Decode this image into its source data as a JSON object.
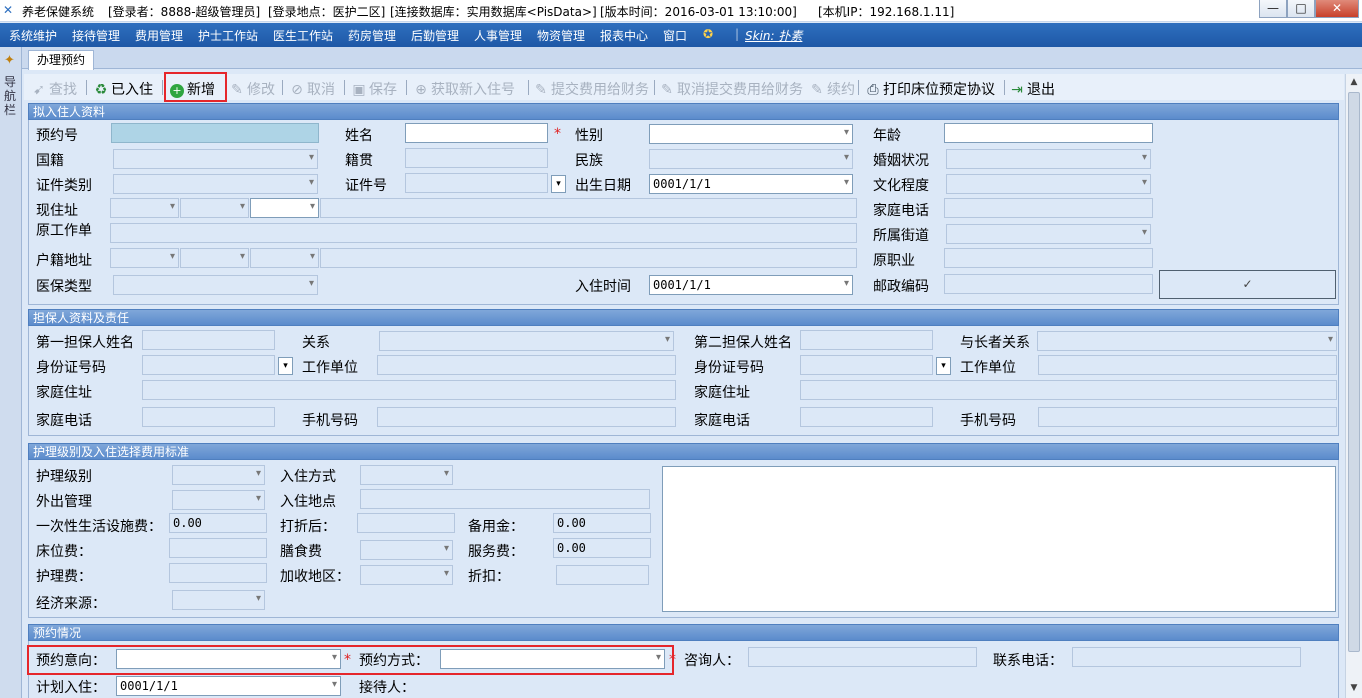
{
  "titlebar": {
    "app": "养老保健系统",
    "user": "[登录者：8888-超级管理员]",
    "location": "[登录地点：医护二区]",
    "db": "[连接数据库：实用数据库<PisData>]",
    "version": "[版本时间：2016-03-01 13:10:00]",
    "ip": "[本机IP：192.168.1.11]",
    "min": "—",
    "max": "□",
    "close": "✕"
  },
  "menu": [
    "系统维护",
    "接待管理",
    "费用管理",
    "护士工作站",
    "医生工作站",
    "药房管理",
    "后勤管理",
    "人事管理",
    "物资管理",
    "报表中心",
    "窗口"
  ],
  "skin_label": "Skin: 扑素",
  "left_strip_label": "导航栏",
  "tab_label": "办理预约",
  "toolbar": {
    "find": "查找",
    "checked_in": "已入住",
    "add": "新增",
    "edit": "修改",
    "cancel": "取消",
    "save": "保存",
    "get_new": "获取新入住号",
    "submit_fee": "提交费用给财务",
    "cancel_submit": "取消提交费用给财务",
    "renew": "续约",
    "print": "打印床位预定协议",
    "exit": "退出"
  },
  "sec1": {
    "title": "拟入住人资料",
    "reserve_no": "预约号",
    "name": "姓名",
    "gender": "性别",
    "age": "年龄",
    "nationality": "国籍",
    "native": "籍贯",
    "ethnic": "民族",
    "marital": "婚姻状况",
    "id_type": "证件类别",
    "id_no": "证件号",
    "birth": "出生日期",
    "birth_value": "0001/1/1",
    "education": "文化程度",
    "address": "现住址",
    "home_phone": "家庭电话",
    "former_work": "原工作单",
    "street": "所属街道",
    "hukou": "户籍地址",
    "former_job": "原职业",
    "insurance": "医保类型",
    "checkin_time": "入住时间",
    "checkin_value": "0001/1/1",
    "postcode": "邮政编码"
  },
  "sec2": {
    "title": "担保人资料及责任",
    "g1_name": "第一担保人姓名",
    "relation": "关系",
    "g2_name": "第二担保人姓名",
    "elder_relation": "与长者关系",
    "id_no": "身份证号码",
    "work_unit": "工作单位",
    "home_address": "家庭住址",
    "home_phone": "家庭电话",
    "mobile": "手机号码"
  },
  "sec3": {
    "title": "护理级别及入住选择费用标准",
    "care_level": "护理级别",
    "checkin_mode": "入住方式",
    "outing": "外出管理",
    "checkin_place": "入住地点",
    "facility_fee": "一次性生活设施费：",
    "facility_value": "0.00",
    "after_discount": "打折后：",
    "reserve_fund": "备用金：",
    "reserve_value": "0.00",
    "bed_fee": "床位费：",
    "meal_fee": "膳食费",
    "service_fee": "服务费：",
    "service_value": "0.00",
    "care_fee": "护理费：",
    "surcharge": "加收地区：",
    "discount": "折扣：",
    "funding": "经济来源："
  },
  "sec4": {
    "title": "预约情况",
    "intent": "预约意向：",
    "method": "预约方式：",
    "consultant": "咨询人：",
    "contact": "联系电话：",
    "plan_date": "计划入住：",
    "plan_value": "0001/1/1",
    "receptionist": "接待人："
  },
  "colors": {
    "accent": "#1e58a6",
    "highlight": "#e5262b"
  }
}
